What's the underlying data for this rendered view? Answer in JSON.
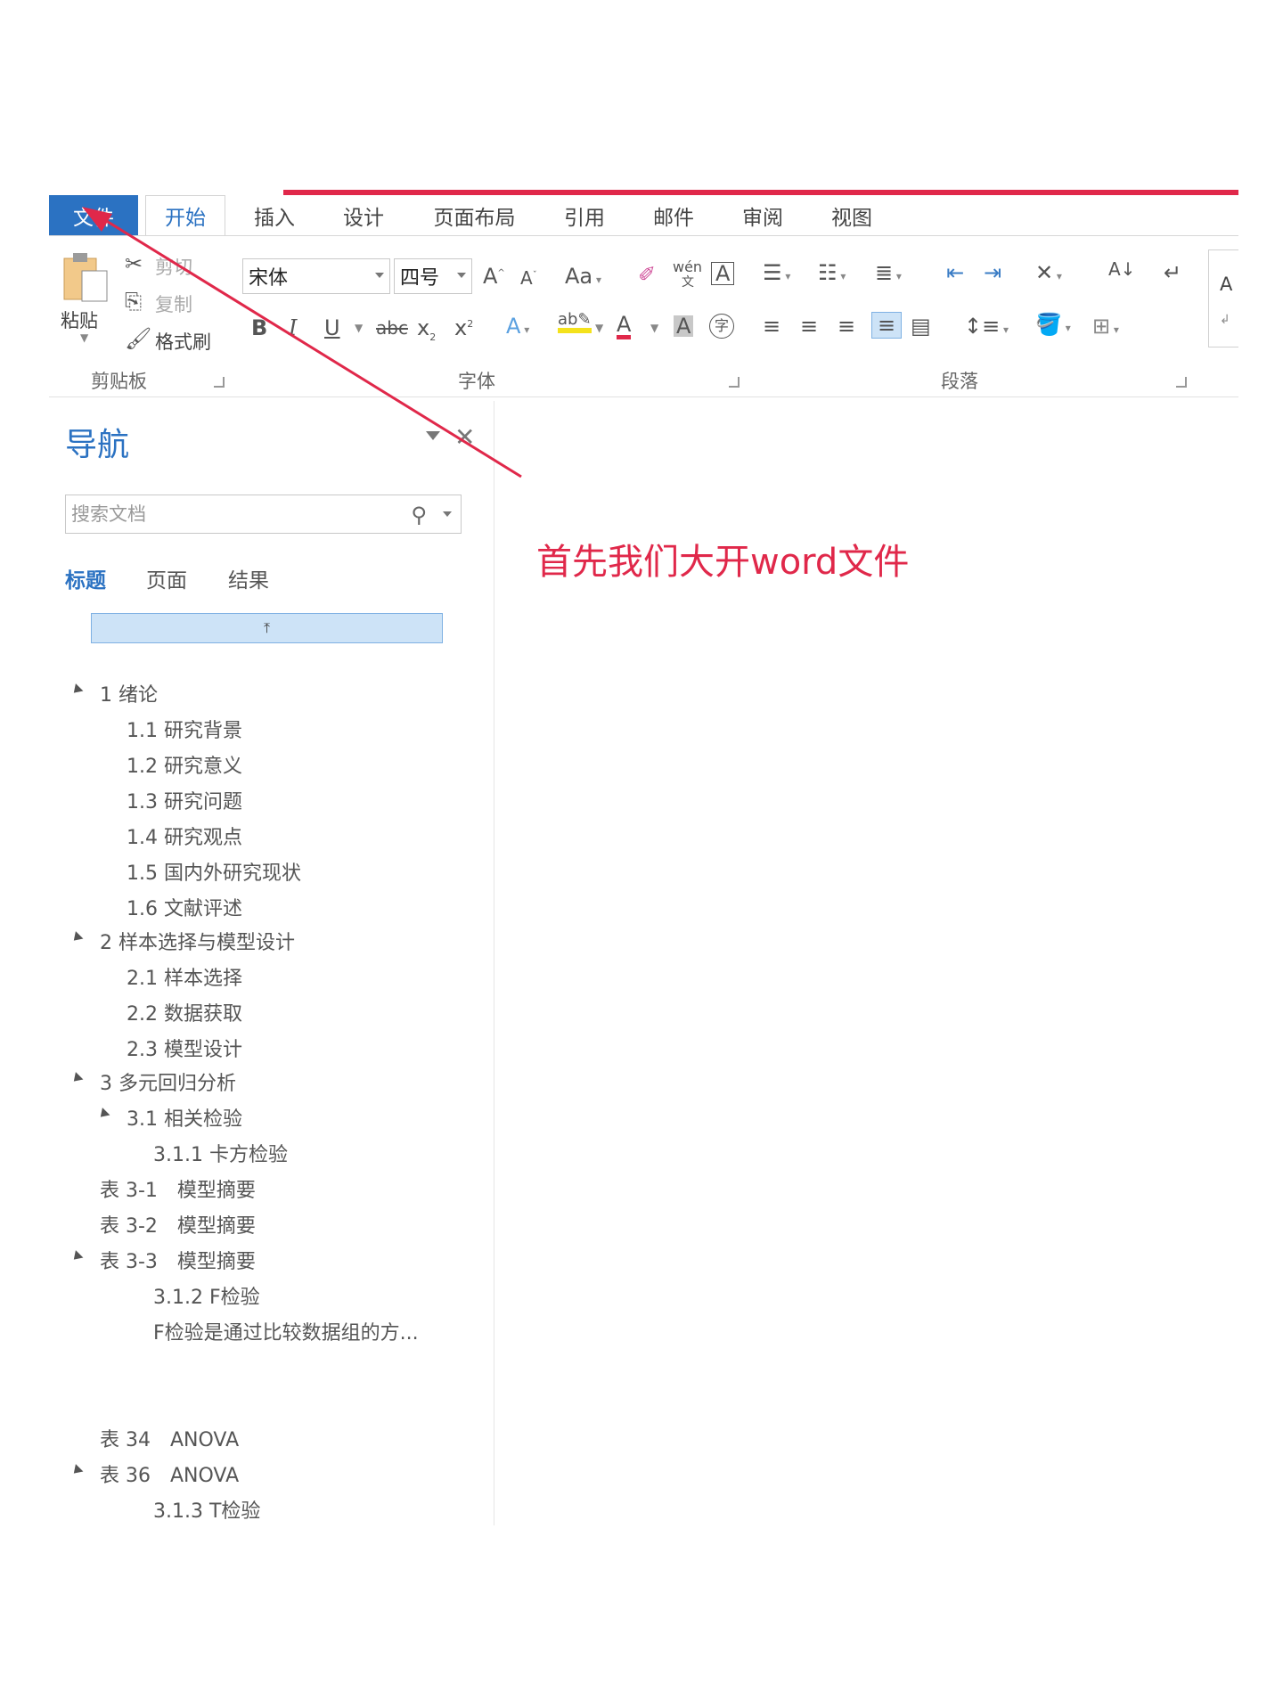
{
  "ribbon_tabs": [
    {
      "label": "文件"
    },
    {
      "label": "开始"
    },
    {
      "label": "插入"
    },
    {
      "label": "设计"
    },
    {
      "label": "页面布局"
    },
    {
      "label": "引用"
    },
    {
      "label": "邮件"
    },
    {
      "label": "审阅"
    },
    {
      "label": "视图"
    }
  ],
  "clipboard": {
    "paste": "粘贴",
    "cut": "剪切",
    "copy": "复制",
    "format_painter": "格式刷",
    "group_label": "剪贴板"
  },
  "font": {
    "name": "宋体",
    "size": "四号",
    "group_label": "字体",
    "aa": "Aa",
    "wen": "wén",
    "wen_char": "文"
  },
  "paragraph": {
    "group_label": "段落"
  },
  "styles_partial": "A",
  "nav": {
    "title": "导航",
    "search_placeholder": "搜索文档",
    "tabs": [
      "标题",
      "页面",
      "结果"
    ]
  },
  "outline": [
    "1 绪论",
    "1.1 研究背景",
    "1.2 研究意义",
    "1.3 研究问题",
    "1.4 研究观点",
    "1.5 国内外研究现状",
    "1.6 文献评述",
    "2 样本选择与模型设计",
    "2.1 样本选择",
    "2.2 数据获取",
    "2.3 模型设计",
    "3 多元回归分析",
    "3.1 相关检验",
    "3.1.1 卡方检验",
    "表 3-1　模型摘要",
    "表 3-2　模型摘要",
    "表 3-3　模型摘要",
    "3.1.2 F检验",
    "F检验是通过比较数据组的方...",
    "表 34　ANOVA",
    "表 36　ANOVA",
    "3.1.3 T检验"
  ],
  "annotation": "首先我们大开word文件",
  "colors": {
    "accent": "#2b72c2",
    "annotation_red": "#e0284a",
    "highlight_bar": "#cde3f7"
  }
}
